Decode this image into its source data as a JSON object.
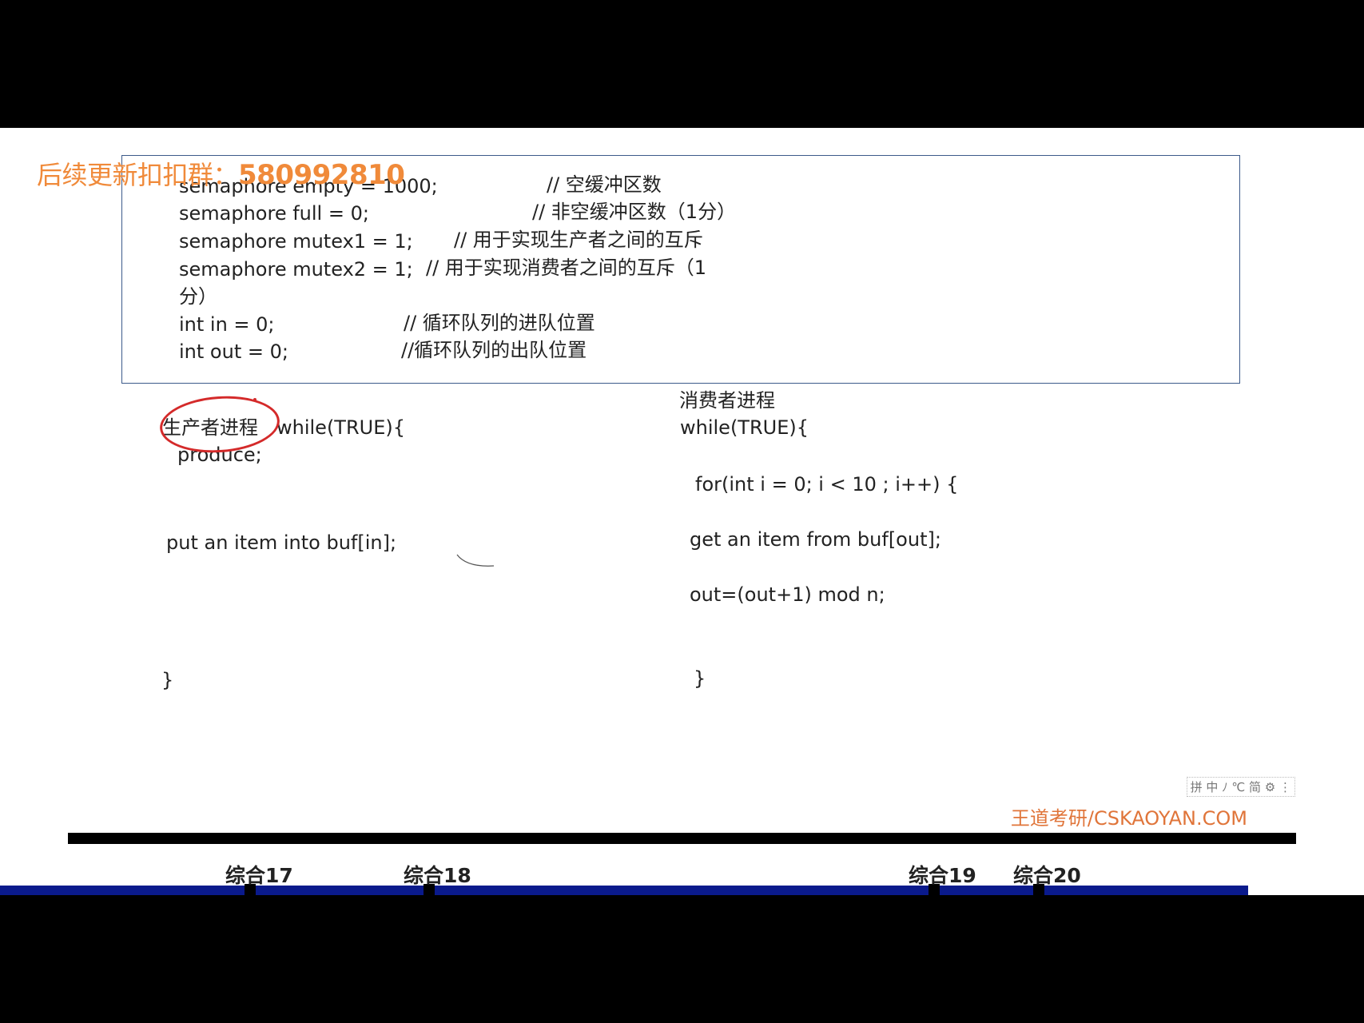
{
  "watermark": {
    "prefix": "后续更新扣扣群：",
    "qq_number": "580992810"
  },
  "declarations": [
    {
      "code": "semaphore empty = 1000;",
      "comment": "// 空缓冲区数"
    },
    {
      "code": "semaphore full = 0;",
      "comment": "// 非空缓冲区数（1分）"
    },
    {
      "code": "semaphore mutex1 = 1;",
      "comment": "//   用于实现生产者之间的互斥"
    },
    {
      "code": "semaphore mutex2 = 1;",
      "comment": "//   用于实现消费者之间的互斥（1"
    },
    {
      "code": "分）",
      "comment": ""
    },
    {
      "code": "int in = 0;",
      "comment": "//  循环队列的进队位置"
    },
    {
      "code": "int out = 0;",
      "comment": "//循环队列的出队位置"
    }
  ],
  "producer": {
    "title": "生产者进程",
    "while_line": "while(TRUE){",
    "produce_line": "produce;",
    "put_line": "put an item into buf[in];",
    "close": "}"
  },
  "consumer": {
    "title": "消费者进程",
    "while_line": "while(TRUE){",
    "for_line": "for(int i = 0; i < 10 ; i++) {",
    "get_line": "get an item from buf[out];",
    "out_line": "out=(out+1) mod n;",
    "close": "}"
  },
  "footer": {
    "brand": "王道考研/CSKAOYAN.COM",
    "ime": "拼 中 ﾉ ℃ 简 ⚙ ⋮"
  },
  "chapters": [
    {
      "label": "综合17"
    },
    {
      "label": "综合18"
    },
    {
      "label": "综合19"
    },
    {
      "label": "综合20"
    }
  ],
  "colors": {
    "watermark": "#f08a3a",
    "annotation": "#d42a2a",
    "chapter_strip": "#0a1a8c",
    "brand": "#e0753a"
  }
}
